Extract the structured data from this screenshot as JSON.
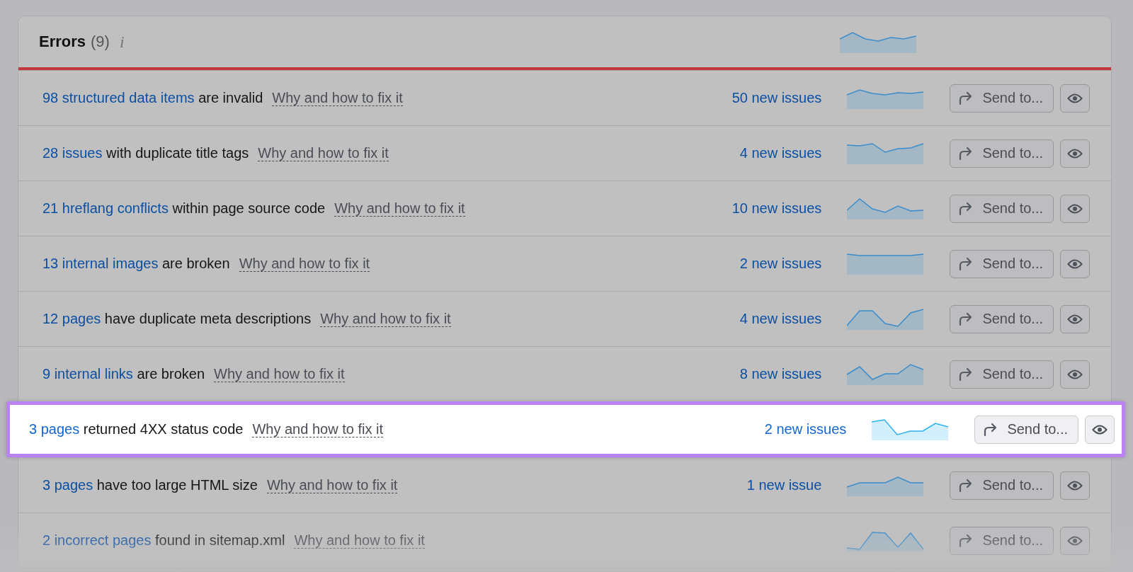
{
  "panel": {
    "title": "Errors",
    "count": "(9)",
    "info_icon": "i"
  },
  "rows": [
    {
      "link": "98 structured data items",
      "text": "are invalid",
      "help": "Why and how to fix it",
      "new_issues": "50 new issues",
      "send": "Send to...",
      "highlighted": false
    },
    {
      "link": "28 issues",
      "text": "with duplicate title tags",
      "help": "Why and how to fix it",
      "new_issues": "4 new issues",
      "send": "Send to...",
      "highlighted": false
    },
    {
      "link": "21 hreflang conflicts",
      "text": "within page source code",
      "help": "Why and how to fix it",
      "new_issues": "10 new issues",
      "send": "Send to...",
      "highlighted": false
    },
    {
      "link": "13 internal images",
      "text": "are broken",
      "help": "Why and how to fix it",
      "new_issues": "2 new issues",
      "send": "Send to...",
      "highlighted": false
    },
    {
      "link": "12 pages",
      "text": "have duplicate meta descriptions",
      "help": "Why and how to fix it",
      "new_issues": "4 new issues",
      "send": "Send to...",
      "highlighted": false
    },
    {
      "link": "9 internal links",
      "text": "are broken",
      "help": "Why and how to fix it",
      "new_issues": "8 new issues",
      "send": "Send to...",
      "highlighted": false
    },
    {
      "link": "3 pages",
      "text": "returned 4XX status code",
      "help": "Why and how to fix it",
      "new_issues": "2 new issues",
      "send": "Send to...",
      "highlighted": true
    },
    {
      "link": "3 pages",
      "text": "have too large HTML size",
      "help": "Why and how to fix it",
      "new_issues": "1 new issue",
      "send": "Send to...",
      "highlighted": false
    },
    {
      "link": "2 incorrect pages",
      "text": "found in sitemap.xml",
      "help": "Why and how to fix it",
      "send": "Send to...",
      "highlighted": false
    }
  ]
}
